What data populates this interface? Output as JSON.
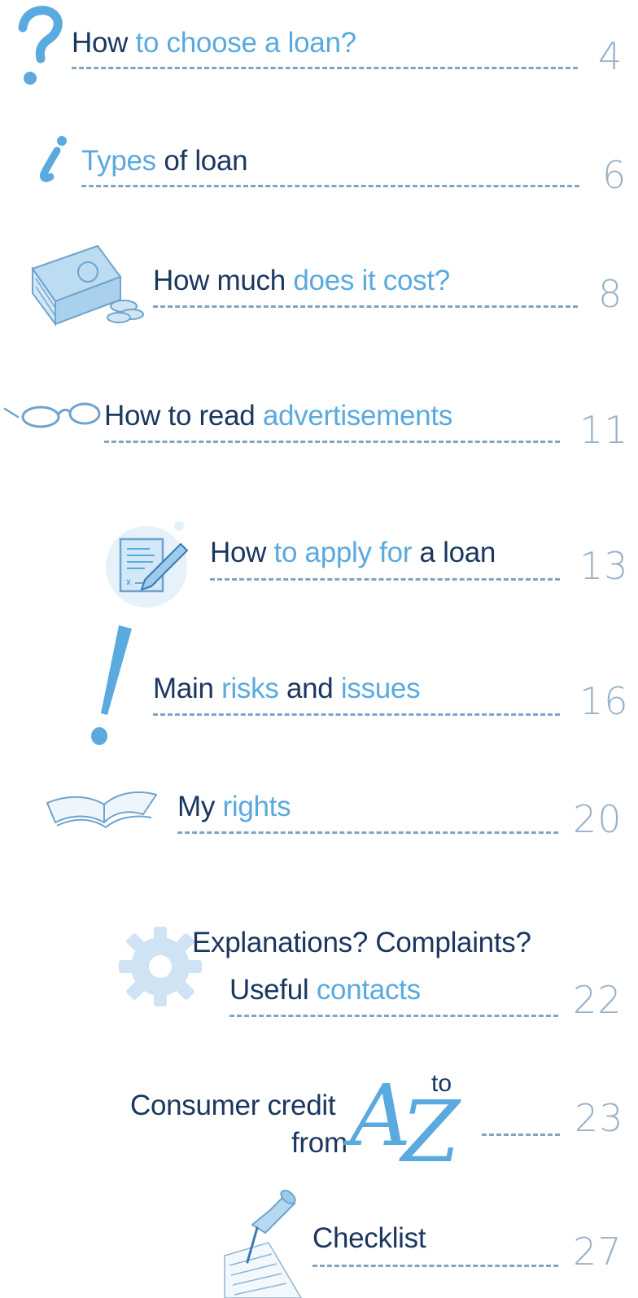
{
  "toc": [
    {
      "title": [
        {
          "text": "How ",
          "tone": "dark"
        },
        {
          "text": "to choose a loan?",
          "tone": "light"
        }
      ],
      "page": "4",
      "icon": "question-mark-icon"
    },
    {
      "title": [
        {
          "text": "Types",
          "tone": "light"
        },
        {
          "text": " of loan",
          "tone": "dark"
        }
      ],
      "page": "6",
      "icon": "info-i-icon"
    },
    {
      "title": [
        {
          "text": "How much ",
          "tone": "dark"
        },
        {
          "text": "does it cost?",
          "tone": "light"
        }
      ],
      "page": "8",
      "icon": "money-stack-icon"
    },
    {
      "title": [
        {
          "text": "How to read ",
          "tone": "dark"
        },
        {
          "text": "advertisements",
          "tone": "light"
        }
      ],
      "page": "11",
      "icon": "glasses-icon"
    },
    {
      "title": [
        {
          "text": "How ",
          "tone": "dark"
        },
        {
          "text": "to apply for ",
          "tone": "light"
        },
        {
          "text": "a loan",
          "tone": "dark"
        }
      ],
      "page": "13",
      "icon": "document-pen-icon"
    },
    {
      "title": [
        {
          "text": "Main ",
          "tone": "dark"
        },
        {
          "text": "risks",
          "tone": "light"
        },
        {
          "text": " and ",
          "tone": "dark"
        },
        {
          "text": "issues",
          "tone": "light"
        }
      ],
      "page": "16",
      "icon": "exclamation-mark-icon"
    },
    {
      "title": [
        {
          "text": "My ",
          "tone": "dark"
        },
        {
          "text": "rights",
          "tone": "light"
        }
      ],
      "page": "20",
      "icon": "open-book-icon"
    },
    {
      "title": [
        {
          "text": "Explanations? Complaints?",
          "tone": "dark"
        }
      ],
      "title2": [
        {
          "text": "Useful ",
          "tone": "dark"
        },
        {
          "text": "contacts",
          "tone": "light"
        }
      ],
      "page": "22",
      "icon": "gear-icon"
    },
    {
      "title": [
        {
          "text": "Consumer credit",
          "tone": "dark"
        }
      ],
      "title2": [
        {
          "text": "from",
          "tone": "dark"
        }
      ],
      "a": "A",
      "to": "to",
      "z": "Z",
      "page": "23",
      "icon": "a-to-z-icon"
    },
    {
      "title": [
        {
          "text": "Checklist",
          "tone": "dark"
        }
      ],
      "page": "27",
      "icon": "pinned-note-icon"
    }
  ],
  "colors": {
    "dark": "#1a3760",
    "light": "#5aa9df",
    "dash": "#7fa4c6",
    "page": "#9ab2c9"
  }
}
